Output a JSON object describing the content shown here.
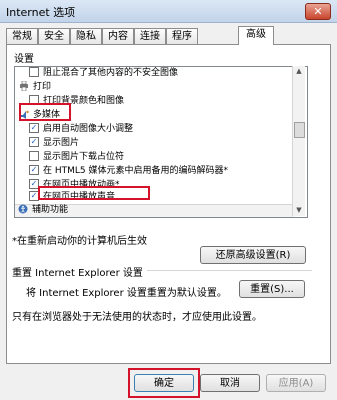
{
  "window": {
    "title": "Internet 选项",
    "close_glyph": "✕"
  },
  "tabs": [
    "常规",
    "安全",
    "隐私",
    "内容",
    "连接",
    "程序",
    "高级"
  ],
  "settings": {
    "group_label": "设置",
    "items": [
      {
        "type": "checkbox",
        "checked": false,
        "label": "阻止混合了其他内容的不安全图像"
      },
      {
        "type": "category",
        "icon": "printer-icon",
        "label": "打印"
      },
      {
        "type": "checkbox",
        "checked": false,
        "label": "打印背景颜色和图像"
      },
      {
        "type": "category",
        "icon": "multimedia-icon",
        "label": "多媒体"
      },
      {
        "type": "checkbox",
        "checked": true,
        "label": "启用自动图像大小调整"
      },
      {
        "type": "checkbox",
        "checked": true,
        "label": "显示图片"
      },
      {
        "type": "checkbox",
        "checked": false,
        "label": "显示图片下载占位符"
      },
      {
        "type": "checkbox",
        "checked": true,
        "label": "在 HTML5 媒体元素中启用备用的编码解码器*"
      },
      {
        "type": "checkbox",
        "checked": true,
        "label": "在网页中播放动画*"
      },
      {
        "type": "checkbox",
        "checked": true,
        "label": "在网页中播放声音"
      },
      {
        "type": "category",
        "icon": "accessibility-icon",
        "label": "辅助功能"
      }
    ],
    "restart_note": "*在重新启动你的计算机后生效",
    "restore_button": "还原高级设置(R)"
  },
  "reset": {
    "group_label": "重置 Internet Explorer 设置",
    "description": "将 Internet Explorer 设置重置为默认设置。",
    "reset_button": "重置(S)...",
    "note": "只有在浏览器处于无法使用的状态时，才应使用此设置。"
  },
  "footer": {
    "ok": "确定",
    "cancel": "取消",
    "apply": "应用(A)"
  },
  "colors": {
    "highlight": "#d4122a",
    "checkmark": "#1b5fbf"
  }
}
